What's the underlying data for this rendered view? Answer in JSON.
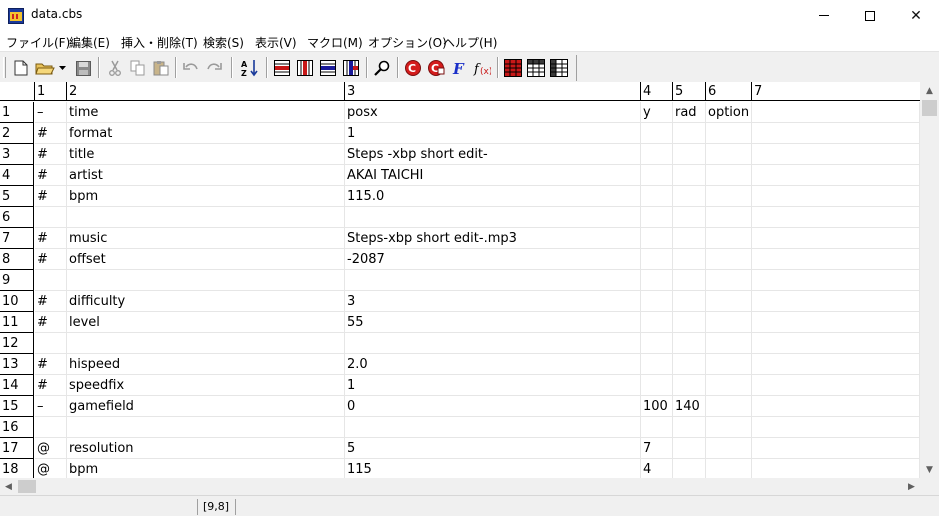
{
  "window": {
    "title": "data.cbs",
    "minimize_icon": "minimize-icon",
    "maximize_icon": "maximize-icon",
    "close_icon": "close-icon",
    "close_glyph": "✕"
  },
  "menu": {
    "items": [
      {
        "label": "ファイル(F)"
      },
      {
        "label": "編集(E)"
      },
      {
        "label": "挿入・削除(T)"
      },
      {
        "label": "検索(S)"
      },
      {
        "label": "表示(V)"
      },
      {
        "label": "マクロ(M)"
      },
      {
        "label": "オプション(O)"
      },
      {
        "label": "ヘルプ(H)"
      }
    ]
  },
  "toolbar": {
    "icons": [
      "new-file-icon",
      "open-folder-icon",
      "save-icon",
      "cut-icon",
      "copy-icon",
      "paste-icon",
      "undo-icon",
      "redo-icon",
      "sort-az-icon",
      "grid-icon",
      "search-icon",
      "font-icon",
      "table-icon"
    ]
  },
  "grid": {
    "columns": [
      "1",
      "2",
      "3",
      "4",
      "5",
      "6",
      "7"
    ],
    "rows": [
      {
        "num": "1",
        "cells": [
          "–",
          "time",
          "posx",
          "y",
          "rad",
          "option",
          ""
        ]
      },
      {
        "num": "2",
        "cells": [
          "#",
          "format",
          "1",
          "",
          "",
          "",
          ""
        ]
      },
      {
        "num": "3",
        "cells": [
          "#",
          "title",
          "Steps -xbp short edit-",
          "",
          "",
          "",
          ""
        ]
      },
      {
        "num": "4",
        "cells": [
          "#",
          "artist",
          "AKAI TAICHI",
          "",
          "",
          "",
          ""
        ]
      },
      {
        "num": "5",
        "cells": [
          "#",
          "bpm",
          "115.0",
          "",
          "",
          "",
          ""
        ]
      },
      {
        "num": "6",
        "cells": [
          "",
          "",
          "",
          "",
          "",
          "",
          ""
        ]
      },
      {
        "num": "7",
        "cells": [
          "#",
          "music",
          "Steps-xbp short edit-.mp3",
          "",
          "",
          "",
          ""
        ]
      },
      {
        "num": "8",
        "cells": [
          "#",
          "offset",
          "-2087",
          "",
          "",
          "",
          ""
        ]
      },
      {
        "num": "9",
        "cells": [
          "",
          "",
          "",
          "",
          "",
          "",
          ""
        ]
      },
      {
        "num": "10",
        "cells": [
          "#",
          "difficulty",
          "3",
          "",
          "",
          "",
          ""
        ]
      },
      {
        "num": "11",
        "cells": [
          "#",
          "level",
          "55",
          "",
          "",
          "",
          ""
        ]
      },
      {
        "num": "12",
        "cells": [
          "",
          "",
          "",
          "",
          "",
          "",
          ""
        ]
      },
      {
        "num": "13",
        "cells": [
          "#",
          "hispeed",
          "2.0",
          "",
          "",
          "",
          ""
        ]
      },
      {
        "num": "14",
        "cells": [
          "#",
          "speedfix",
          "1",
          "",
          "",
          "",
          ""
        ]
      },
      {
        "num": "15",
        "cells": [
          "–",
          "gamefield",
          "0",
          "100",
          "140",
          "",
          ""
        ]
      },
      {
        "num": "16",
        "cells": [
          "",
          "",
          "",
          "",
          "",
          "",
          ""
        ]
      },
      {
        "num": "17",
        "cells": [
          "@",
          "resolution",
          "5",
          "7",
          "",
          "",
          ""
        ]
      },
      {
        "num": "18",
        "cells": [
          "@",
          "bpm",
          "115",
          "4",
          "",
          "",
          ""
        ]
      }
    ]
  },
  "scrollbars": {
    "up_glyph": "▲",
    "down_glyph": "▼",
    "left_glyph": "◀",
    "right_glyph": "▶"
  },
  "status": {
    "position": "[9,8]"
  }
}
